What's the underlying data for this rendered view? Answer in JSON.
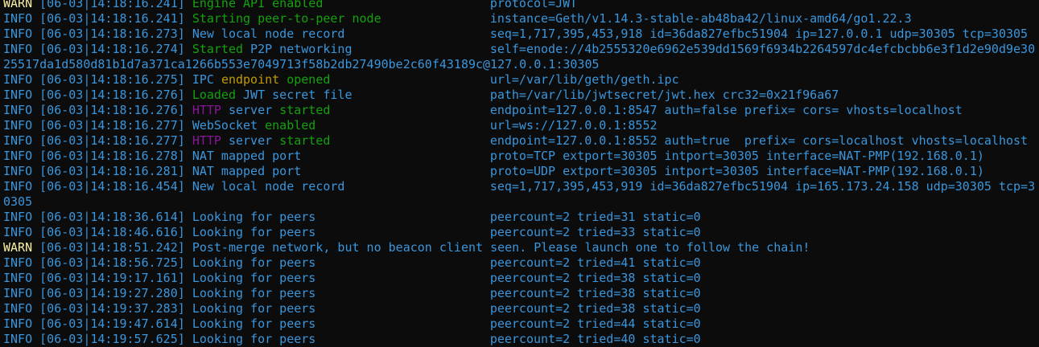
{
  "window": {
    "background": "#0c0c0c",
    "colors": {
      "info": "#3a96dd",
      "warn": "#f9f1a5",
      "gray": "#cccccc",
      "green": "#13a10e",
      "yellow": "#c19c00",
      "magenta": "#881798"
    }
  },
  "lines": [
    {
      "level": "WARN",
      "levelColor": "warn",
      "ts": "[06-03|14:18:16.241]",
      "msg": [
        {
          "t": "Engine API enabled",
          "c": "green"
        }
      ],
      "kv": "protocol=JWT",
      "partial": true
    },
    {
      "level": "INFO",
      "levelColor": "info",
      "ts": "[06-03|14:18:16.241]",
      "msg": [
        {
          "t": "Starting peer-to-peer node",
          "c": "green"
        }
      ],
      "kv": "instance=Geth/v1.14.3-stable-ab48ba42/linux-amd64/go1.22.3"
    },
    {
      "level": "INFO",
      "levelColor": "info",
      "ts": "[06-03|14:18:16.273]",
      "msg": [
        {
          "t": "New local node record",
          "c": "info"
        }
      ],
      "kv": "seq=1,717,395,453,918 id=36da827efbc51904 ip=127.0.0.1 udp=30305 tcp=30305"
    },
    {
      "level": "INFO",
      "levelColor": "info",
      "ts": "[06-03|14:18:16.274]",
      "msg": [
        {
          "t": "Started",
          "c": "green"
        },
        {
          "t": " P2P networking",
          "c": "info"
        }
      ],
      "kv": "self=enode://4b2555320e6962e539dd1569f6934b2264597dc4efcbcbb6e3f1d2e90d9e30"
    },
    {
      "wrap": "25517da1d580d81b1d7a371ca1266b553e7049713f58b2db27490be2c60f43189c@127.0.0.1:30305"
    },
    {
      "level": "INFO",
      "levelColor": "info",
      "ts": "[06-03|14:18:16.275]",
      "msg": [
        {
          "t": "IPC ",
          "c": "info"
        },
        {
          "t": "endpoint",
          "c": "yellow"
        },
        {
          "t": " opened",
          "c": "green"
        }
      ],
      "kv": "url=/var/lib/geth/geth.ipc"
    },
    {
      "level": "INFO",
      "levelColor": "info",
      "ts": "[06-03|14:18:16.276]",
      "msg": [
        {
          "t": "Loaded",
          "c": "green"
        },
        {
          "t": " JWT secret file",
          "c": "info"
        }
      ],
      "kv": "path=/var/lib/jwtsecret/jwt.hex crc32=0x21f96a67"
    },
    {
      "level": "INFO",
      "levelColor": "info",
      "ts": "[06-03|14:18:16.276]",
      "msg": [
        {
          "t": "HTTP",
          "c": "magenta"
        },
        {
          "t": " server ",
          "c": "info"
        },
        {
          "t": "started",
          "c": "green"
        }
      ],
      "kv": "endpoint=127.0.0.1:8547 auth=false prefix= cors= vhosts=localhost"
    },
    {
      "level": "INFO",
      "levelColor": "info",
      "ts": "[06-03|14:18:16.277]",
      "msg": [
        {
          "t": "WebSocket ",
          "c": "info"
        },
        {
          "t": "enabled",
          "c": "green"
        }
      ],
      "kv": "url=ws://127.0.0.1:8552"
    },
    {
      "level": "INFO",
      "levelColor": "info",
      "ts": "[06-03|14:18:16.277]",
      "msg": [
        {
          "t": "HTTP",
          "c": "magenta"
        },
        {
          "t": " server ",
          "c": "info"
        },
        {
          "t": "started",
          "c": "green"
        }
      ],
      "kv": "endpoint=127.0.0.1:8552 auth=true  prefix= cors=localhost vhosts=localhost"
    },
    {
      "level": "INFO",
      "levelColor": "info",
      "ts": "[06-03|14:18:16.278]",
      "msg": [
        {
          "t": "NAT mapped port",
          "c": "info"
        }
      ],
      "kv": "proto=TCP extport=30305 intport=30305 interface=NAT-PMP(192.168.0.1)"
    },
    {
      "level": "INFO",
      "levelColor": "info",
      "ts": "[06-03|14:18:16.281]",
      "msg": [
        {
          "t": "NAT mapped port",
          "c": "info"
        }
      ],
      "kv": "proto=UDP extport=30305 intport=30305 interface=NAT-PMP(192.168.0.1)"
    },
    {
      "level": "INFO",
      "levelColor": "info",
      "ts": "[06-03|14:18:16.454]",
      "msg": [
        {
          "t": "New local node record",
          "c": "info"
        }
      ],
      "kv": "seq=1,717,395,453,919 id=36da827efbc51904 ip=165.173.24.158 udp=30305 tcp=3"
    },
    {
      "wrap": "0305"
    },
    {
      "level": "INFO",
      "levelColor": "info",
      "ts": "[06-03|14:18:36.614]",
      "msg": [
        {
          "t": "Looking for peers",
          "c": "info"
        }
      ],
      "kv": "peercount=2 tried=31 static=0"
    },
    {
      "level": "INFO",
      "levelColor": "info",
      "ts": "[06-03|14:18:46.616]",
      "msg": [
        {
          "t": "Looking for peers",
          "c": "info"
        }
      ],
      "kv": "peercount=2 tried=33 static=0"
    },
    {
      "level": "WARN",
      "levelColor": "warn",
      "ts": "[06-03|14:18:51.242]",
      "msg": [
        {
          "t": "Post-merge network, but no beacon client seen. Please launch one to follow the chain!",
          "c": "info"
        }
      ],
      "kv": ""
    },
    {
      "level": "INFO",
      "levelColor": "info",
      "ts": "[06-03|14:18:56.725]",
      "msg": [
        {
          "t": "Looking for peers",
          "c": "info"
        }
      ],
      "kv": "peercount=2 tried=41 static=0"
    },
    {
      "level": "INFO",
      "levelColor": "info",
      "ts": "[06-03|14:19:17.161]",
      "msg": [
        {
          "t": "Looking for peers",
          "c": "info"
        }
      ],
      "kv": "peercount=2 tried=38 static=0"
    },
    {
      "level": "INFO",
      "levelColor": "info",
      "ts": "[06-03|14:19:27.280]",
      "msg": [
        {
          "t": "Looking for peers",
          "c": "info"
        }
      ],
      "kv": "peercount=2 tried=38 static=0"
    },
    {
      "level": "INFO",
      "levelColor": "info",
      "ts": "[06-03|14:19:37.283]",
      "msg": [
        {
          "t": "Looking for peers",
          "c": "info"
        }
      ],
      "kv": "peercount=2 tried=38 static=0"
    },
    {
      "level": "INFO",
      "levelColor": "info",
      "ts": "[06-03|14:19:47.614]",
      "msg": [
        {
          "t": "Looking for peers",
          "c": "info"
        }
      ],
      "kv": "peercount=2 tried=44 static=0"
    },
    {
      "level": "INFO",
      "levelColor": "info",
      "ts": "[06-03|14:19:57.625]",
      "msg": [
        {
          "t": "Looking for peers",
          "c": "info"
        }
      ],
      "kv": "peercount=2 tried=40 static=0"
    }
  ]
}
